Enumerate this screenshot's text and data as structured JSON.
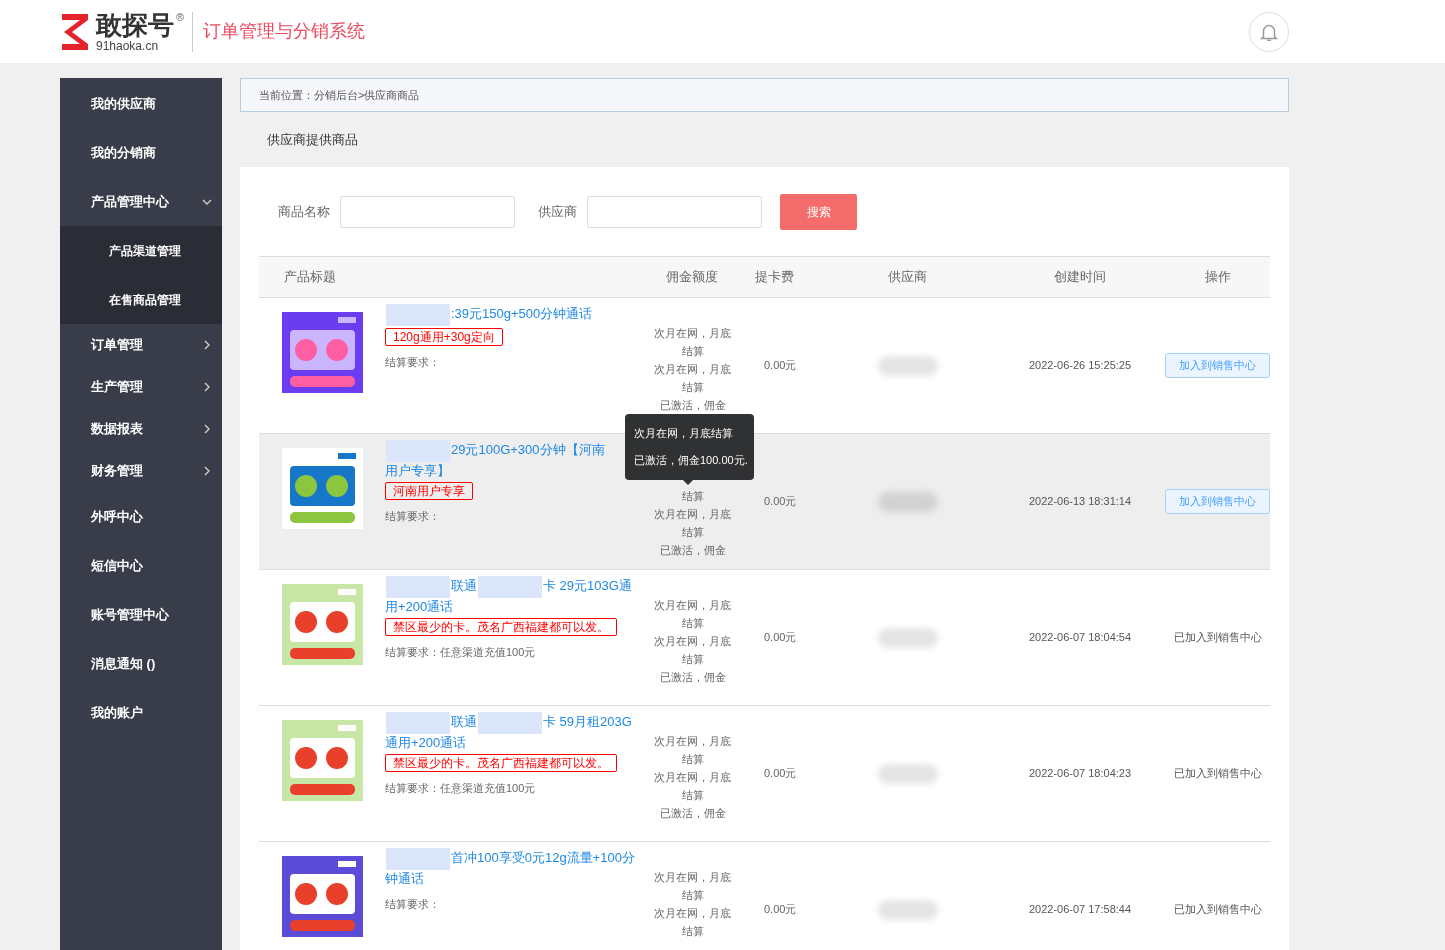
{
  "header": {
    "logo_name": "敢探号",
    "logo_mark": "®",
    "logo_domain": "91haoka.cn",
    "system_title": "订单管理与分销系统"
  },
  "sidebar": {
    "items": [
      {
        "label": "我的供应商",
        "kind": "plain"
      },
      {
        "label": "我的分销商",
        "kind": "plain"
      },
      {
        "label": "产品管理中心",
        "kind": "group",
        "expanded": true,
        "children": [
          {
            "label": "产品渠道管理"
          },
          {
            "label": "在售商品管理"
          }
        ]
      },
      {
        "label": "订单管理",
        "kind": "group",
        "expanded": false
      },
      {
        "label": "生产管理",
        "kind": "group",
        "expanded": false
      },
      {
        "label": "数据报表",
        "kind": "group",
        "expanded": false
      },
      {
        "label": "财务管理",
        "kind": "group",
        "expanded": false
      },
      {
        "label": "外呼中心",
        "kind": "plain"
      },
      {
        "label": "短信中心",
        "kind": "plain"
      },
      {
        "label": "账号管理中心",
        "kind": "plain"
      },
      {
        "label": "消息通知 ()",
        "kind": "plain"
      },
      {
        "label": "我的账户",
        "kind": "plain"
      }
    ]
  },
  "breadcrumb": "当前位置：分销后台>供应商商品",
  "section_title": "供应商提供商品",
  "filters": [
    {
      "label": "商品名称"
    },
    {
      "label": "供应商"
    }
  ],
  "search_button": "搜索",
  "table": {
    "columns": [
      "产品标题",
      "佣金额度",
      "提卡费",
      "供应商",
      "创建时间",
      "操作"
    ],
    "rows": [
      {
        "hovered": false,
        "thumbnail": {
          "kind": "picture"
        },
        "title_parts": [
          {
            "kind": "blur"
          },
          {
            "kind": "text",
            "text": ":39元150g+500分钟通话"
          }
        ],
        "tag": "120g通用+30g定向",
        "requirement": "结算要求：",
        "commission": [
          "次月在网，月底结算",
          "次月在网，月底结算",
          "已激活，佣金"
        ],
        "fee": "0.00元",
        "created": "2022-06-26 15:25:25",
        "action": {
          "kind": "button",
          "label": "加入到销售中心"
        }
      },
      {
        "hovered": true,
        "thumbnail": {
          "kind": "picture"
        },
        "title_parts": [
          {
            "kind": "blur"
          },
          {
            "kind": "text",
            "text": "29元100G+300分钟【河南用户专享】"
          }
        ],
        "tag": "河南用户专享",
        "requirement": "结算要求：",
        "commission": [
          "结算",
          "次月在网，月底结算",
          "已激活，佣金"
        ],
        "fee": "0.00元",
        "created": "2022-06-13 18:31:14",
        "action": {
          "kind": "button",
          "label": "加入到销售中心"
        },
        "tooltip": [
          "次月在网，月底结算",
          "已激活，佣金100.00元."
        ]
      },
      {
        "hovered": false,
        "thumbnail": {
          "kind": "picture"
        },
        "title_parts": [
          {
            "kind": "blur"
          },
          {
            "kind": "text",
            "text": "联通"
          },
          {
            "kind": "blur"
          },
          {
            "kind": "text",
            "text": "卡 29元103G通用+200通话"
          }
        ],
        "tag": "禁区最少的卡。茂名广西福建都可以发。",
        "requirement": "结算要求：任意渠道充值100元",
        "commission": [
          "次月在网，月底结算",
          "次月在网，月底结算",
          "已激活，佣金"
        ],
        "fee": "0.00元",
        "created": "2022-06-07 18:04:54",
        "action": {
          "kind": "text",
          "label": "已加入到销售中心"
        }
      },
      {
        "hovered": false,
        "thumbnail": {
          "kind": "picture"
        },
        "title_parts": [
          {
            "kind": "blur"
          },
          {
            "kind": "text",
            "text": "联通"
          },
          {
            "kind": "blur"
          },
          {
            "kind": "text",
            "text": "卡 59月租203G通用+200通话"
          }
        ],
        "tag": "禁区最少的卡。茂名广西福建都可以发。",
        "requirement": "结算要求：任意渠道充值100元",
        "commission": [
          "次月在网，月底结算",
          "次月在网，月底结算",
          "已激活，佣金"
        ],
        "fee": "0.00元",
        "created": "2022-06-07 18:04:23",
        "action": {
          "kind": "text",
          "label": "已加入到销售中心"
        }
      },
      {
        "hovered": false,
        "thumbnail": {
          "kind": "picture"
        },
        "title_parts": [
          {
            "kind": "blur"
          },
          {
            "kind": "text",
            "text": "首冲100享受0元12g流量+100分钟通话"
          }
        ],
        "requirement": "结算要求：",
        "commission": [
          "次月在网，月底结算",
          "次月在网，月底结算"
        ],
        "fee": "0.00元",
        "created": "2022-06-07 17:58:44",
        "action": {
          "kind": "text",
          "label": "已加入到销售中心"
        }
      }
    ]
  }
}
